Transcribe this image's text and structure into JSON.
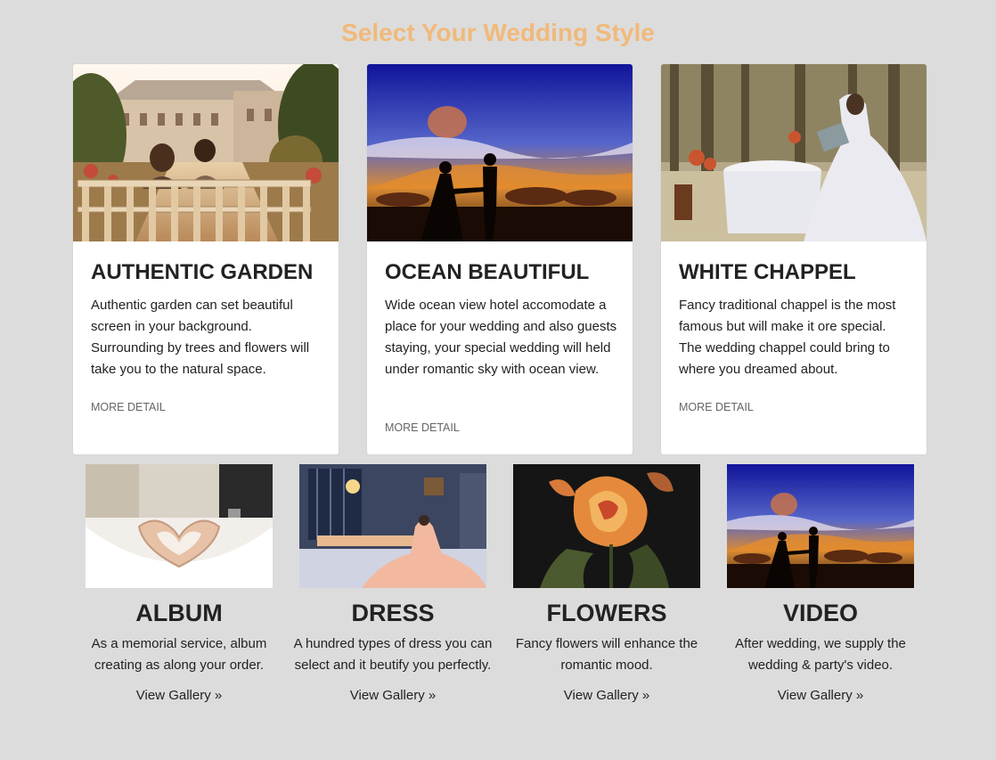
{
  "page": {
    "title": "Select Your Wedding Style"
  },
  "styles": [
    {
      "title": "AUTHENTIC GARDEN",
      "image": "garden-couple-bench-photo",
      "description": "Authentic garden can set beautiful screen in your background. Surrounding by trees and flowers will take you to the natural space.",
      "link": "MORE DETAIL"
    },
    {
      "title": "OCEAN BEAUTIFUL",
      "image": "ocean-sunset-couple-photo",
      "description": "Wide ocean view hotel accomodate a place for your wedding and also guests staying, your special wedding will held under romantic sky with ocean view.",
      "link": "MORE DETAIL"
    },
    {
      "title": "WHITE CHAPPEL",
      "image": "forest-bride-table-photo",
      "description": "Fancy traditional chappel is the most famous but will make it ore special. The wedding chappel could bring to where you dreamed about.",
      "link": "MORE DETAIL"
    }
  ],
  "services": [
    {
      "title": "ALBUM",
      "image": "hands-heart-photo",
      "description": "As a memorial service, album creating as along your order.",
      "link": "View Gallery »"
    },
    {
      "title": "DRESS",
      "image": "bride-dress-room-photo",
      "description": "A hundred types of dress you can select and it beutify you perfectly.",
      "link": "View Gallery »"
    },
    {
      "title": "FLOWERS",
      "image": "orange-rose-photo",
      "description": "Fancy flowers will enhance the romantic mood.",
      "link": "View Gallery »"
    },
    {
      "title": "VIDEO",
      "image": "sunset-couple-photo",
      "description": "After wedding, we supply the wedding & party's video.",
      "link": "View Gallery »"
    }
  ],
  "colors": {
    "background": "#dcdcdc",
    "title_accent": "#f1b97a",
    "card": "#ffffff",
    "text": "#222222",
    "muted_link": "#666666"
  }
}
